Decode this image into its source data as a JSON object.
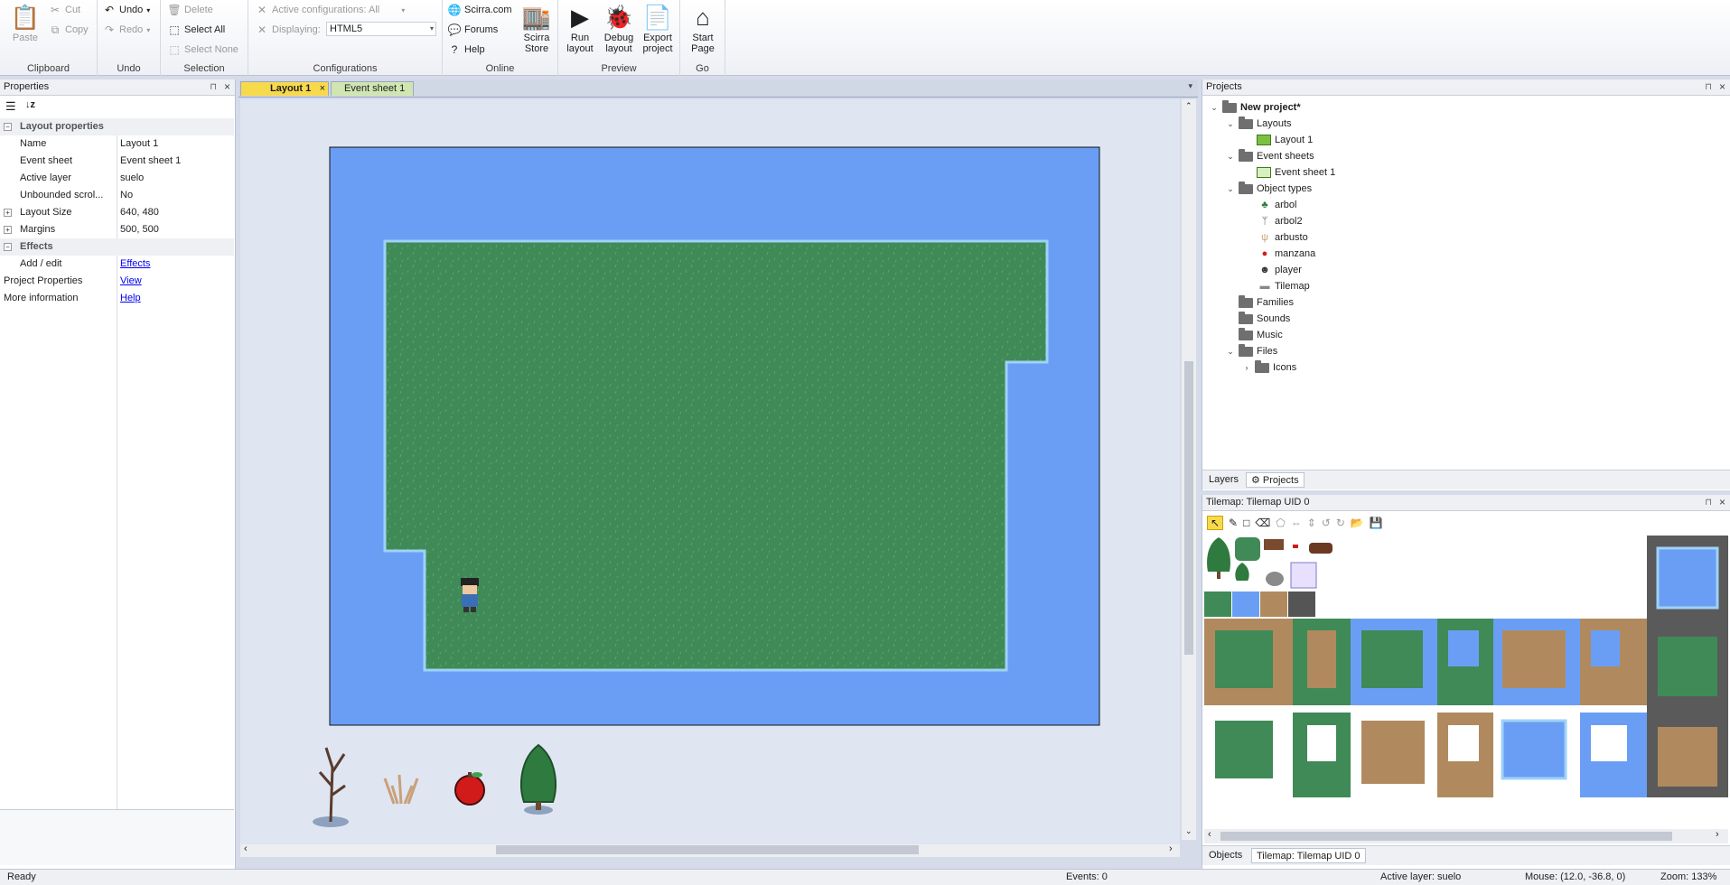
{
  "ribbon": {
    "clipboard": {
      "title": "Clipboard",
      "paste": "Paste",
      "cut": "Cut",
      "copy": "Copy"
    },
    "undo": {
      "title": "Undo",
      "undo": "Undo",
      "redo": "Redo"
    },
    "selection": {
      "title": "Selection",
      "delete": "Delete",
      "select_all": "Select All",
      "select_none": "Select None"
    },
    "configurations": {
      "title": "Configurations",
      "active": "Active configurations: All",
      "displaying_label": "Displaying:",
      "displaying_value": "HTML5"
    },
    "online": {
      "title": "Online",
      "scirra": "Scirra.com",
      "forums": "Forums",
      "help": "Help",
      "store_line1": "Scirra",
      "store_line2": "Store"
    },
    "preview": {
      "title": "Preview",
      "run1": "Run",
      "run2": "layout",
      "debug1": "Debug",
      "debug2": "layout",
      "export1": "Export",
      "export2": "project"
    },
    "go": {
      "title": "Go",
      "start1": "Start",
      "start2": "Page"
    }
  },
  "properties": {
    "title": "Properties",
    "section_layout": "Layout properties",
    "rows": [
      {
        "k": "Name",
        "v": "Layout 1"
      },
      {
        "k": "Event sheet",
        "v": "Event sheet 1"
      },
      {
        "k": "Active layer",
        "v": "suelo"
      },
      {
        "k": "Unbounded scrol...",
        "v": "No"
      },
      {
        "k": "Layout Size",
        "v": "640, 480"
      },
      {
        "k": "Margins",
        "v": "500, 500"
      }
    ],
    "section_effects": "Effects",
    "add_edit": "Add / edit",
    "effects_link": "Effects",
    "project_props": "Project Properties",
    "view_link": "View",
    "more_info": "More information",
    "help_link": "Help"
  },
  "editor": {
    "tab_layout": "Layout 1",
    "tab_events": "Event sheet 1"
  },
  "projects": {
    "title": "Projects",
    "root": "New project*",
    "layouts": "Layouts",
    "layout1": "Layout 1",
    "event_sheets": "Event sheets",
    "event_sheet1": "Event sheet 1",
    "object_types": "Object types",
    "objects": [
      "arbol",
      "arbol2",
      "arbusto",
      "manzana",
      "player",
      "Tilemap"
    ],
    "families": "Families",
    "sounds": "Sounds",
    "music": "Music",
    "files": "Files",
    "icons": "Icons",
    "tab_layers": "Layers",
    "tab_projects": "Projects"
  },
  "tilemap": {
    "title": "Tilemap: Tilemap UID 0",
    "tab_objects": "Objects",
    "tab_tilemap": "Tilemap: Tilemap UID 0"
  },
  "status": {
    "ready": "Ready",
    "events": "Events: 0",
    "active_layer": "Active layer: suelo",
    "mouse": "Mouse: (12.0, -36.8, 0)",
    "zoom": "Zoom: 133%"
  },
  "colors": {
    "water": "#6a9ef5",
    "grass": "#3f8a57",
    "accent": "#f7d94c"
  }
}
